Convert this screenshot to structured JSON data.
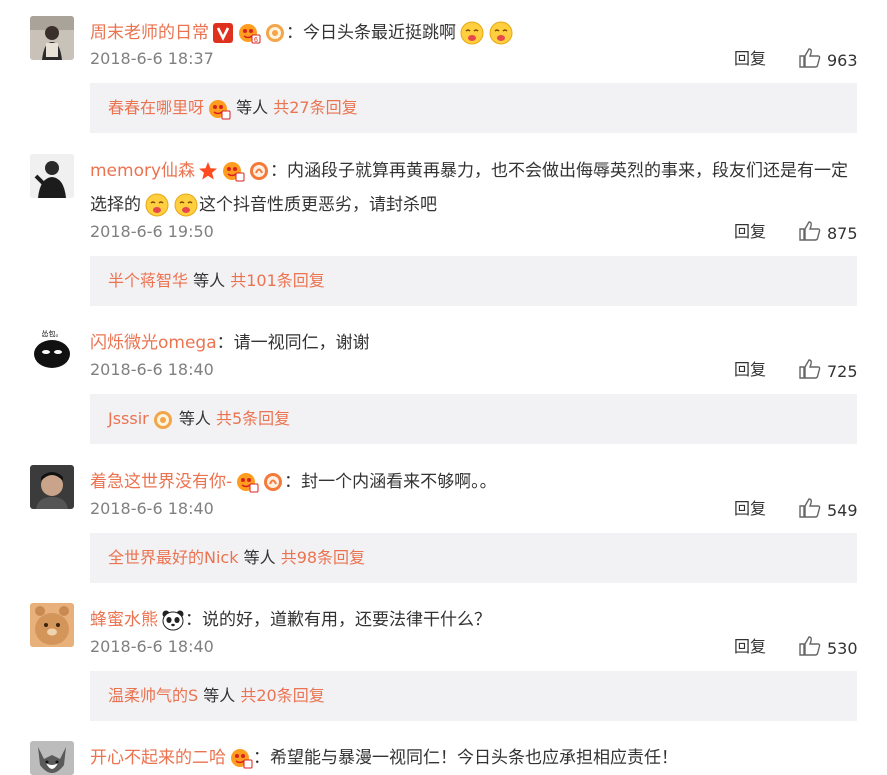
{
  "comments": [
    {
      "username": "周末老师的日常",
      "separator": "：",
      "text": "今日头条最近挺跳啊",
      "date": "2018-6-6 18:37",
      "reply_label": "回复",
      "likes": "963",
      "sub_user": "春春在哪里呀",
      "sub_middle": "等人",
      "sub_count": "共27条回复"
    },
    {
      "username": "memory仙森",
      "separator": "：",
      "text": "内涵段子就算再黄再暴力，也不会做出侮辱英烈的事来，段友们还是有一定选择的",
      "text2": "这个抖音性质更恶劣，请封杀吧",
      "date": "2018-6-6 19:50",
      "reply_label": "回复",
      "likes": "875",
      "sub_user": "半个蒋智华",
      "sub_middle": "等人",
      "sub_count": "共101条回复"
    },
    {
      "username": "闪烁微光omega",
      "separator": "：",
      "text": "请一视同仁，谢谢",
      "avatar_text": "怂包。",
      "date": "2018-6-6 18:40",
      "reply_label": "回复",
      "likes": "725",
      "sub_user": "Jsssir",
      "sub_middle": "等人",
      "sub_count": "共5条回复"
    },
    {
      "username": "着急这世界没有你-",
      "separator": "：",
      "text": "封一个内涵看来不够啊。。",
      "date": "2018-6-6 18:40",
      "reply_label": "回复",
      "likes": "549",
      "sub_user": "全世界最好的Nick",
      "sub_middle": "等人",
      "sub_count": "共98条回复"
    },
    {
      "username": "蜂蜜水熊",
      "separator": "：",
      "text": "说的好，道歉有用，还要法律干什么？",
      "date": "2018-6-6 18:40",
      "reply_label": "回复",
      "likes": "530",
      "sub_user": "温柔帅气的S",
      "sub_middle": "等人",
      "sub_count": "共20条回复"
    },
    {
      "username": "开心不起来的二哈",
      "separator": "：",
      "text": "希望能与暴漫一视同仁！今日头条也应承担相应责任！"
    }
  ],
  "colors": {
    "username": "#eb7350",
    "link": "#eb7350",
    "meta": "#808080",
    "sub_bg": "#f2f2f5"
  }
}
